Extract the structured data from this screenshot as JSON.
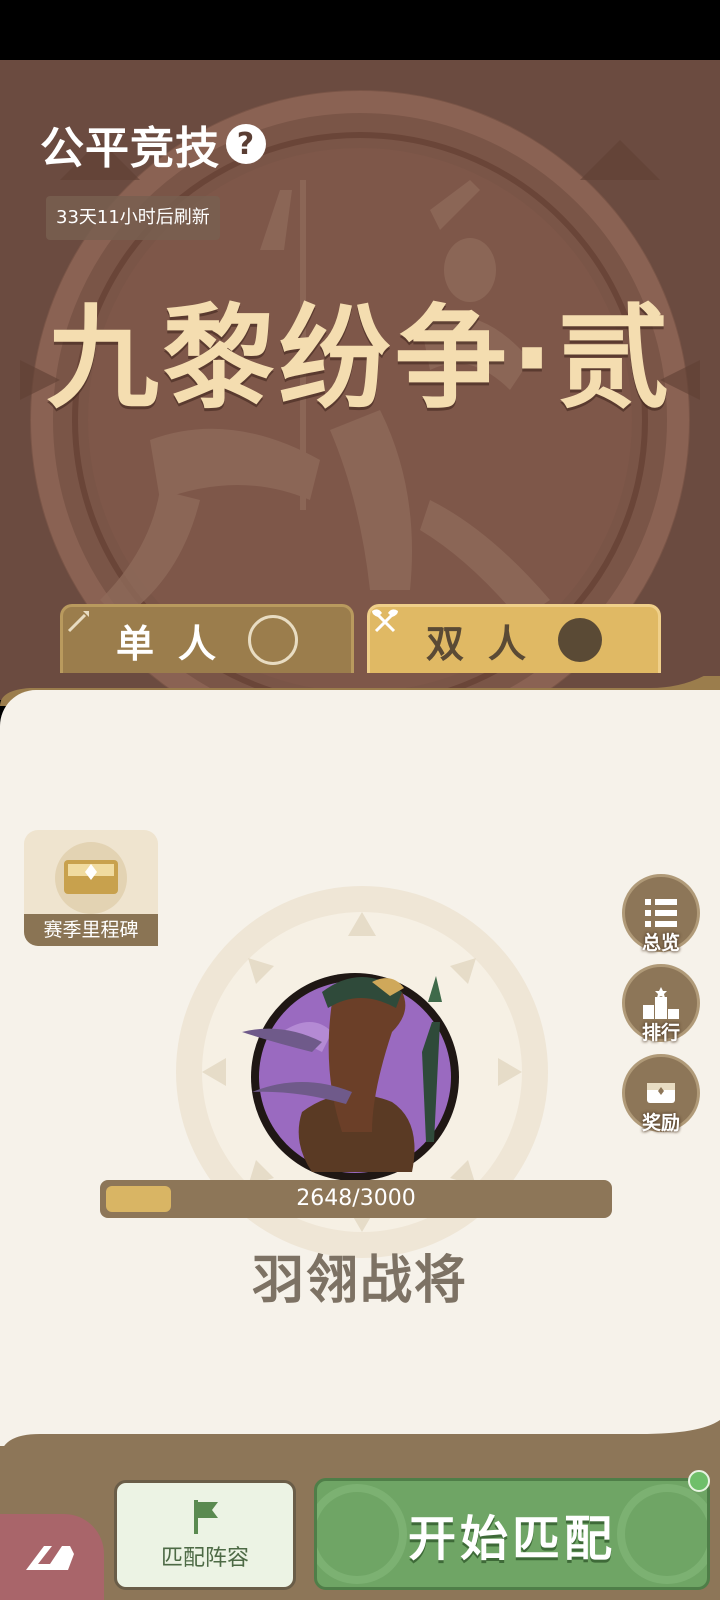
{
  "header": {
    "title": "公平竞技",
    "help_icon": "question-icon",
    "refresh_text": "33天11小时后刷新",
    "event_title": "九黎纷争·贰"
  },
  "tabs": [
    {
      "label": "单人",
      "icon": "spear-icon",
      "selected": false
    },
    {
      "label": "双人",
      "icon": "crossed-axes-icon",
      "selected": true
    }
  ],
  "milestone": {
    "label": "赛季里程碑",
    "icon": "chest-icon"
  },
  "side_menu": [
    {
      "label": "总览",
      "icon": "list-icon"
    },
    {
      "label": "排行",
      "icon": "podium-icon"
    },
    {
      "label": "奖励",
      "icon": "chest-icon"
    }
  ],
  "rank": {
    "progress_text": "2648/3000",
    "progress_fraction": 0.13,
    "name": "羽翎战将"
  },
  "footer": {
    "lineup_label": "匹配阵容",
    "lineup_icon": "flag-icon",
    "start_label": "开始匹配",
    "corner_icon": "logo-icon"
  },
  "colors": {
    "accent_gold": "#e0b964",
    "panel_bg": "#f6f2ea",
    "footer_bg": "#8d7658",
    "start_green": "#6fa565"
  }
}
